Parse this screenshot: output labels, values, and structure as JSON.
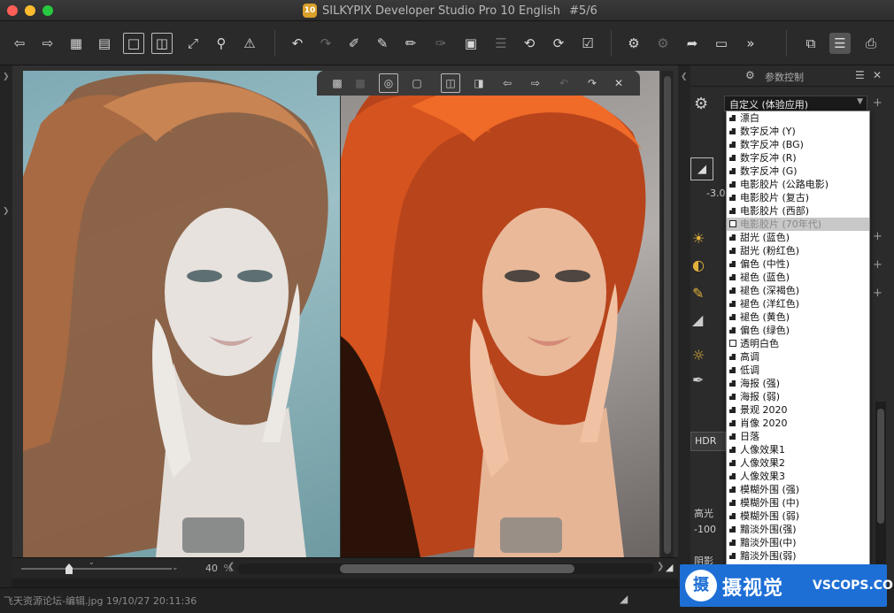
{
  "window": {
    "badge": "10",
    "title": "SILKYPIX Developer Studio Pro 10 English",
    "counter": "#5/6"
  },
  "toolbar_icons": [
    "prev-image-icon",
    "next-image-icon",
    "grid-view-icon",
    "filmstrip-view-icon",
    "single-view-icon",
    "compare-view-icon",
    "fullscreen-icon",
    "zoom-icon",
    "warning-icon",
    "undo-icon",
    "redo-icon",
    "develop-tool-icon",
    "brush-tool-icon",
    "eraser-icon",
    "stamp-icon",
    "crop-icon",
    "layers-icon",
    "rotate-left-icon",
    "rotate-right-icon",
    "check-mark-icon",
    "batch-develop-icon",
    "settings-compare-icon",
    "export-icon",
    "monitor-icon",
    "more-icon",
    "window-layout-icon",
    "sliders-icon",
    "printer-icon"
  ],
  "viewer": {
    "zoom_value": "40",
    "zoom_unit": "%"
  },
  "status": {
    "file_info": "飞天资源论坛-编辑.jpg 19/10/27 20:11:36"
  },
  "panel": {
    "title": "参数控制",
    "preset_value": "自定义 (体验应用)",
    "ev_value": "-3.0",
    "hdr_label": "HDR",
    "highlight_label": "高光",
    "highlight_value": "-100",
    "shadow_label": "阴影"
  },
  "dropdown": {
    "items": [
      {
        "label": "漂白"
      },
      {
        "label": "数字反冲 (Y)"
      },
      {
        "label": "数字反冲 (BG)"
      },
      {
        "label": "数字反冲 (R)"
      },
      {
        "label": "数字反冲 (G)"
      },
      {
        "label": "电影胶片 (公路电影)"
      },
      {
        "label": "电影胶片 (复古)"
      },
      {
        "label": "电影胶片 (西部)"
      },
      {
        "label": "电影胶片 (70年代)",
        "highlighted": true
      },
      {
        "label": "甜光 (蓝色)"
      },
      {
        "label": "甜光 (粉红色)"
      },
      {
        "label": "偏色 (中性)"
      },
      {
        "label": "褪色 (蓝色)"
      },
      {
        "label": "褪色 (深褐色)"
      },
      {
        "label": "褪色 (洋红色)"
      },
      {
        "label": "褪色 (黄色)"
      },
      {
        "label": "偏色 (绿色)"
      },
      {
        "label": "透明白色",
        "boxed": true
      },
      {
        "label": "高调"
      },
      {
        "label": "低调"
      },
      {
        "label": "海报 (强)"
      },
      {
        "label": "海报 (弱)"
      },
      {
        "label": "景观 2020"
      },
      {
        "label": "肖像 2020"
      },
      {
        "label": "日落"
      },
      {
        "label": "人像效果1"
      },
      {
        "label": "人像效果2"
      },
      {
        "label": "人像效果3"
      },
      {
        "label": "模糊外围 (强)"
      },
      {
        "label": "模糊外围 (中)"
      },
      {
        "label": "模糊外围 (弱)"
      },
      {
        "label": "黯淡外围(强)"
      },
      {
        "label": "黯淡外围(中)"
      },
      {
        "label": "黯淡外围(弱)"
      }
    ]
  },
  "watermark": {
    "logo_char": "摄",
    "name": "摄视觉",
    "site": "VSCOPS.COM"
  }
}
